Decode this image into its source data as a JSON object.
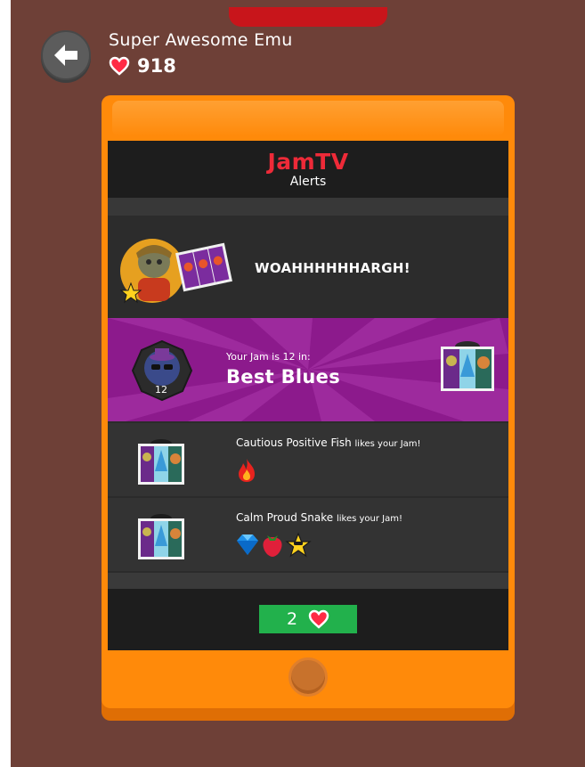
{
  "profile": {
    "username": "Super Awesome Emu",
    "hearts": "918"
  },
  "screen": {
    "logo": "JamTV",
    "subtitle": "Alerts"
  },
  "alerts": {
    "big": {
      "text": "WOAHHHHHHARGH!"
    },
    "rank": {
      "subtitle": "Your Jam is 12 in:",
      "title": "Best Blues",
      "badge_number": "12"
    },
    "likes": [
      {
        "name": "Cautious Positive Fish",
        "action": "likes your Jam!",
        "reactions": [
          "fire-icon"
        ]
      },
      {
        "name": "Calm Proud Snake",
        "action": "likes your Jam!",
        "reactions": [
          "gem-icon",
          "strawberry-icon",
          "star-icon"
        ]
      }
    ]
  },
  "footer": {
    "count": "2"
  },
  "colors": {
    "background": "#6e4037",
    "tablet": "#ff8a0a",
    "accent_green": "#22b14c",
    "purple_banner": "#8c1a8c",
    "logo_red": "#ee2a38"
  }
}
